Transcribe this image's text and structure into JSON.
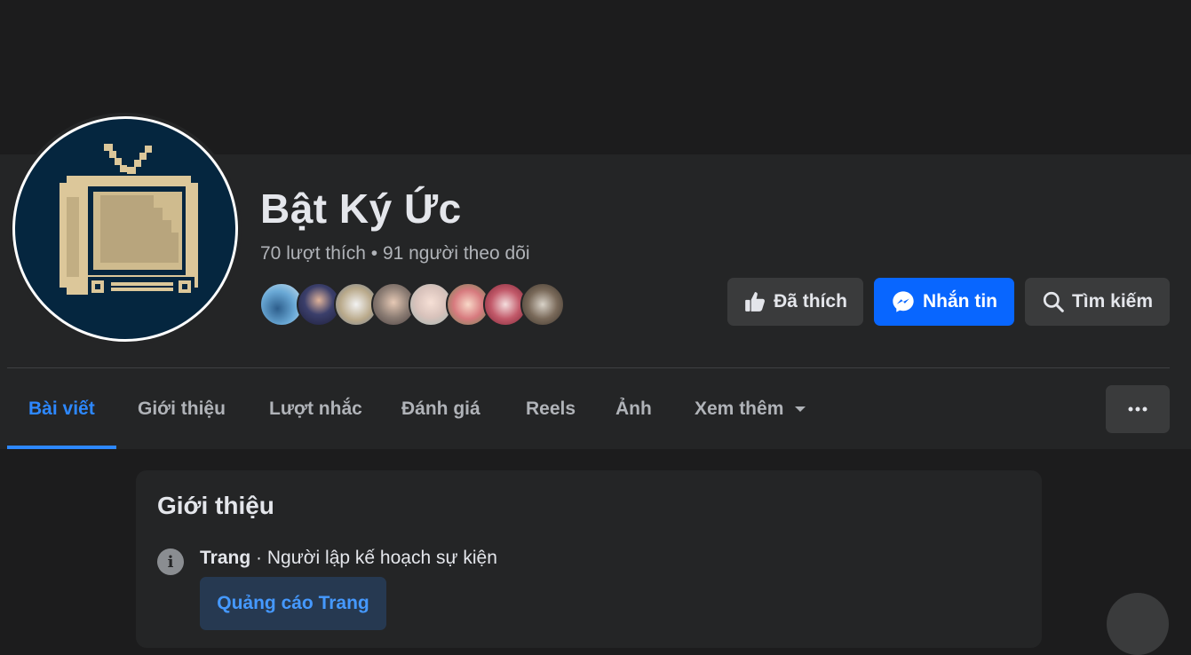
{
  "page": {
    "name": "Bật Ký Ức",
    "likes": "70 lượt thích",
    "separator": "•",
    "followers": "91 người theo dõi"
  },
  "friend_avatars": [
    {
      "color": "#5b8fb9"
    },
    {
      "color": "#3b3f6b"
    },
    {
      "color": "#b9a98a"
    },
    {
      "color": "#8c7d74"
    },
    {
      "color": "#d8c2bb"
    },
    {
      "color": "#d77a7e"
    },
    {
      "color": "#c25a6a"
    },
    {
      "color": "#7a6a5a"
    }
  ],
  "actions": {
    "liked": {
      "label": "Đã thích",
      "icon": "thumbs-up-icon"
    },
    "message": {
      "label": "Nhắn tin",
      "icon": "messenger-icon"
    },
    "search": {
      "label": "Tìm kiếm",
      "icon": "search-icon"
    }
  },
  "tabs": [
    {
      "label": "Bài viết",
      "active": true
    },
    {
      "label": "Giới thiệu"
    },
    {
      "label": "Lượt nhắc"
    },
    {
      "label": "Đánh giá"
    },
    {
      "label": "Reels"
    },
    {
      "label": "Ảnh"
    },
    {
      "label": "Xem thêm",
      "icon": "caret-down-icon"
    }
  ],
  "intro": {
    "title": "Giới thiệu",
    "type_label": "Trang",
    "type_separator": "·",
    "category": "Người lập kế hoạch sự kiện",
    "ad_button": "Quảng cáo Trang"
  },
  "colors": {
    "accent": "#2d88ff",
    "primary_button": "#0866ff",
    "surface": "#242526",
    "background": "#1c1c1d",
    "avatar_bg": "#05263f",
    "tv_body": "#dcc79a"
  }
}
